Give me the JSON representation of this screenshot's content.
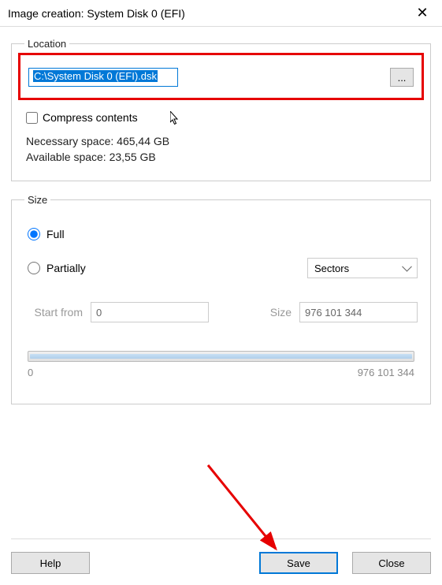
{
  "titlebar": {
    "title": "Image creation: System Disk 0 (EFI)"
  },
  "location": {
    "legend": "Location",
    "path": "C:\\System Disk 0 (EFI).dsk",
    "browse_label": "...",
    "compress_label": "Compress contents",
    "necessary_label": "Necessary space: 465,44 GB",
    "available_label": "Available space: 23,55 GB"
  },
  "size": {
    "legend": "Size",
    "full_label": "Full",
    "partially_label": "Partially",
    "units_selected": "Sectors",
    "start_from_label": "Start from",
    "start_from_value": "0",
    "size_label": "Size",
    "size_value": "976 101 344",
    "slider_min": "0",
    "slider_max": "976 101 344"
  },
  "buttons": {
    "help": "Help",
    "save": "Save",
    "close": "Close"
  }
}
